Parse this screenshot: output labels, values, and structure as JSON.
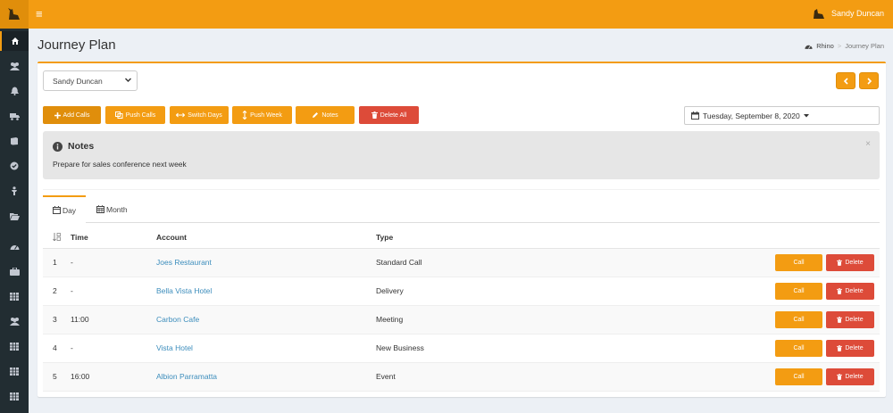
{
  "header": {
    "user_name": "Sandy Duncan"
  },
  "page": {
    "title": "Journey Plan"
  },
  "breadcrumb": {
    "home": "Rhino",
    "current": "Journey Plan"
  },
  "filters": {
    "selected_user": "Sandy Duncan",
    "date": "Tuesday, September 8, 2020"
  },
  "toolbar": {
    "add_calls": "Add Calls",
    "push_calls": "Push Calls",
    "switch_days": "Switch Days",
    "push_week": "Push Week",
    "notes": "Notes",
    "delete_all": "Delete All"
  },
  "notes": {
    "title": "Notes",
    "text": "Prepare for sales conference next week",
    "close": "×"
  },
  "tabs": {
    "day": "Day",
    "month": "Month"
  },
  "table": {
    "headers": {
      "time": "Time",
      "account": "Account",
      "type": "Type"
    },
    "rows": [
      {
        "num": "1",
        "time": "-",
        "account": "Joes Restaurant",
        "type": "Standard Call"
      },
      {
        "num": "2",
        "time": "-",
        "account": "Bella Vista Hotel",
        "type": "Delivery"
      },
      {
        "num": "3",
        "time": "11:00",
        "account": "Carbon Cafe",
        "type": "Meeting"
      },
      {
        "num": "4",
        "time": "-",
        "account": "Vista Hotel",
        "type": "New Business"
      },
      {
        "num": "5",
        "time": "16:00",
        "account": "Albion Parramatta",
        "type": "Event"
      }
    ],
    "call_label": "Call",
    "delete_label": "Delete"
  },
  "colors": {
    "accent": "#f39c12",
    "accent_dark": "#e08e0b",
    "danger": "#dd4b39",
    "sidebar": "#222d32",
    "link": "#3c8dbc"
  }
}
